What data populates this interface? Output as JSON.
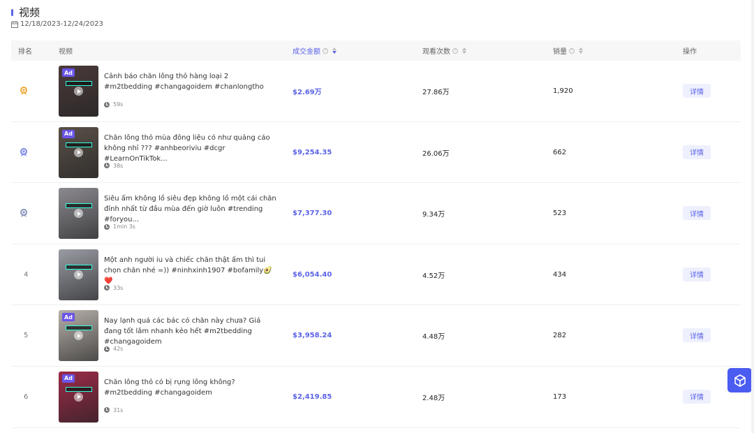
{
  "header": {
    "title": "视频",
    "date_range": "12/18/2023-12/24/2023"
  },
  "columns": {
    "rank": "排名",
    "video": "视频",
    "gmv": "成交金额",
    "views": "观看次数",
    "sales": "销量",
    "action": "操作"
  },
  "rows": [
    {
      "rank": "1",
      "medal": "gold",
      "ad": "Ad",
      "desc": "Cảnh báo chăn lông thỏ hàng loại 2 #m2tbedding #changagoidem #chanlongtho",
      "duration": "59s",
      "gmv": "$2.69万",
      "views": "27.86万",
      "sales": "1,920",
      "detail": "详情",
      "thumb_color": "#4a3a3a"
    },
    {
      "rank": "2",
      "medal": "silver",
      "ad": "Ad",
      "desc": "Chăn lông thỏ mùa đông liệu có như quảng cáo không nhỉ ??? #anhbeoriviu #dcgr #LearnOnTikTok...",
      "duration": "38s",
      "gmv": "$9,254.35",
      "views": "26.06万",
      "sales": "662",
      "detail": "详情",
      "thumb_color": "#5a5048"
    },
    {
      "rank": "3",
      "medal": "bronze",
      "ad": "",
      "desc": "Siêu ấm không lồ siêu đẹp không lồ một cái chăn đỉnh nhất từ đầu mùa đến giờ luôn #trending #foryou...",
      "duration": "1min 3s",
      "gmv": "$7,377.30",
      "views": "9.34万",
      "sales": "523",
      "detail": "详情",
      "thumb_color": "#8c8a90"
    },
    {
      "rank": "4",
      "medal": "",
      "ad": "",
      "desc": "Một anh người iu và chiếc chăn thật ấm thì tui chọn chăn nhé =)) #ninhxinh1907 #bofamily🥑❤️",
      "duration": "33s",
      "gmv": "$6,054.40",
      "views": "4.52万",
      "sales": "434",
      "detail": "详情",
      "thumb_color": "#9a9ca4"
    },
    {
      "rank": "5",
      "medal": "",
      "ad": "Ad",
      "desc": "Nay lạnh quá các bác có chăn này chưa? Giá đang tốt lắm nhanh kẻo hết #m2tbedding #changagoidem",
      "duration": "42s",
      "gmv": "$3,958.24",
      "views": "4.48万",
      "sales": "282",
      "detail": "详情",
      "thumb_color": "#b6b0aa"
    },
    {
      "rank": "6",
      "medal": "",
      "ad": "Ad",
      "desc": "Chăn lông thỏ có bị rụng lông không? #m2tbedding #changagoidem",
      "duration": "31s",
      "gmv": "$2,419.85",
      "views": "2.48万",
      "sales": "173",
      "detail": "详情",
      "thumb_color": "#9c2a48"
    }
  ],
  "colors": {
    "accent": "#5b63e8",
    "gold": "#f2a93b",
    "silver": "#7a86e6",
    "bronze": "#8a94b8"
  }
}
